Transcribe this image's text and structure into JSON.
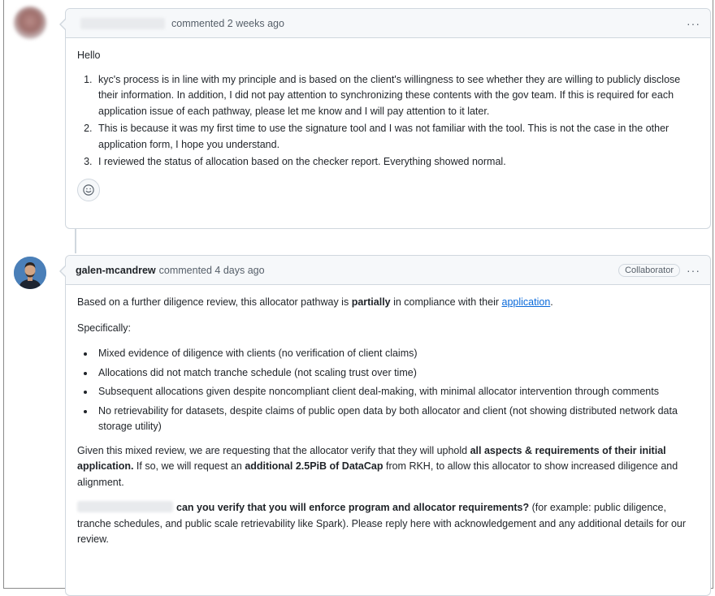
{
  "comment1": {
    "meta": "commented 2 weeks ago",
    "menu_label": "···",
    "greeting": "Hello",
    "items": [
      "kyc's process is in line with my principle and is based on the client's willingness to see whether they are willing to publicly disclose their information. In addition, I did not pay attention to synchronizing these contents with the gov team. If this is required for each application issue of each pathway, please let me know and I will pay attention to it later.",
      "This is because it was my first time to use the signature tool and I was not familiar with the tool. This is not the case in the other application form, I hope you understand.",
      "I reviewed the status of allocation based on the checker report. Everything showed normal."
    ],
    "reaction_icon": "smiley-icon"
  },
  "comment2": {
    "author": "galen-mcandrew",
    "meta": "commented 4 days ago",
    "badge": "Collaborator",
    "menu_label": "···",
    "p1_pre": "Based on a further diligence review, this allocator pathway is ",
    "p1_bold": "partially",
    "p1_mid": " in compliance with their ",
    "p1_link": "application",
    "p1_post": ".",
    "specifically": "Specifically:",
    "bullets": [
      "Mixed evidence of diligence with clients (no verification of client claims)",
      "Allocations did not match tranche schedule (not scaling trust over time)",
      "Subsequent allocations given despite noncompliant client deal-making, with minimal allocator intervention through comments",
      "No retrievability for datasets, despite claims of public open data by both allocator and client (not showing distributed network data storage utility)"
    ],
    "p3_a": "Given this mixed review, we are requesting that the allocator verify that they will uphold ",
    "p3_b": "all aspects & requirements of their initial application.",
    "p3_c": " If so, we will request an ",
    "p3_d": "additional 2.5PiB of DataCap",
    "p3_e": " from RKH, to allow this allocator to show increased diligence and alignment.",
    "p4_bold": "can you verify that you will enforce program and allocator requirements?",
    "p4_rest": " (for example: public diligence, tranche schedules, and public scale retrievability like Spark). Please reply here with acknowledgement and any additional details for our review."
  }
}
